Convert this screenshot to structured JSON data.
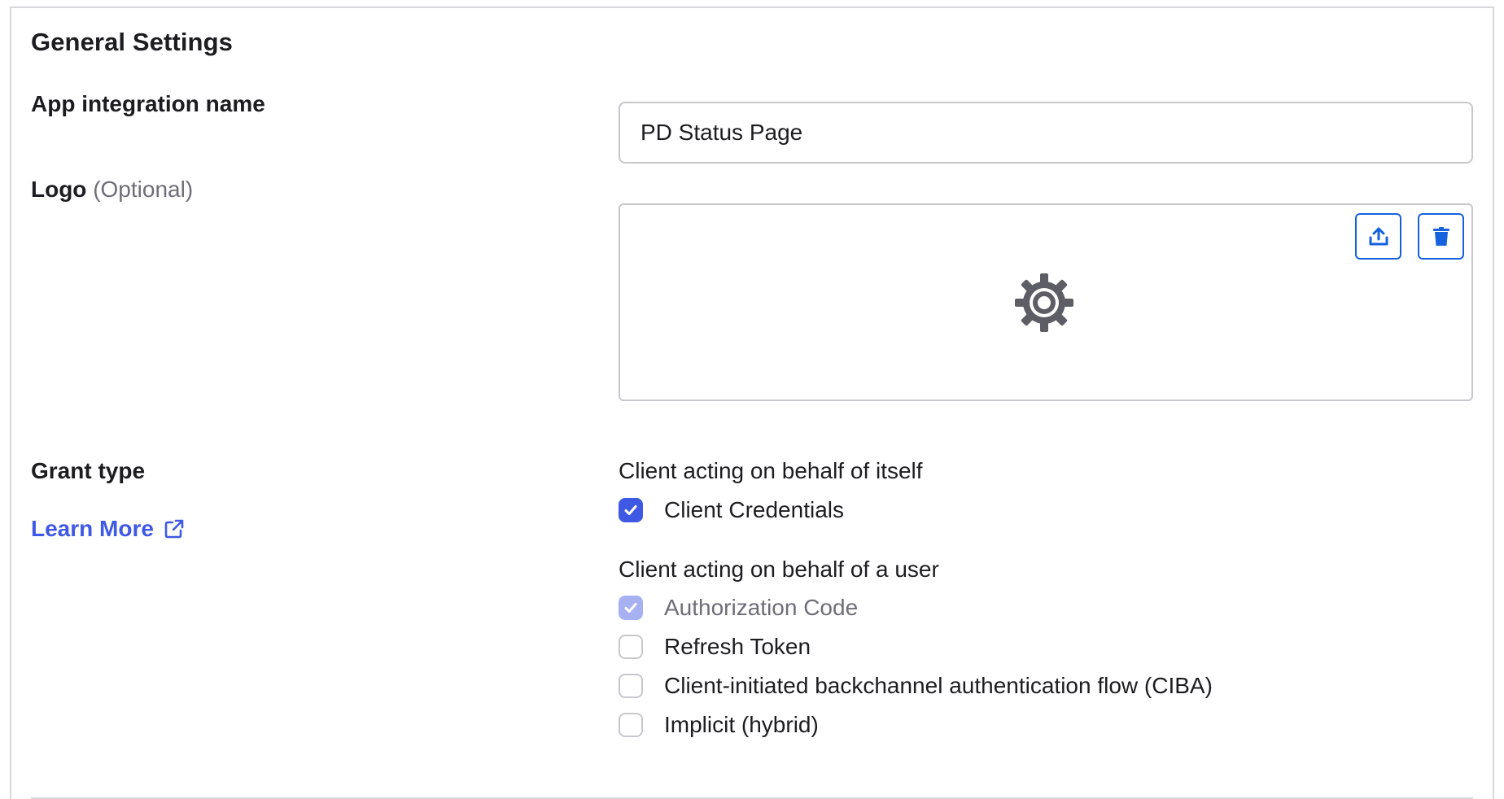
{
  "section": {
    "title": "General Settings"
  },
  "app_name": {
    "label": "App integration name",
    "value": "PD Status Page"
  },
  "logo": {
    "label": "Logo",
    "optional": "(Optional)",
    "upload_icon": "upload-icon",
    "delete_icon": "trash-icon",
    "placeholder_icon": "gear-icon"
  },
  "grant_type": {
    "label": "Grant type",
    "learn_more": "Learn More",
    "learn_more_icon": "external-link-icon",
    "group_self": {
      "heading": "Client acting on behalf of itself",
      "options": [
        {
          "label": "Client Credentials",
          "checked": true,
          "disabled": false
        }
      ]
    },
    "group_user": {
      "heading": "Client acting on behalf of a user",
      "options": [
        {
          "label": "Authorization Code",
          "checked": true,
          "disabled": true
        },
        {
          "label": "Refresh Token",
          "checked": false,
          "disabled": false
        },
        {
          "label": "Client-initiated backchannel authentication flow (CIBA)",
          "checked": false,
          "disabled": false
        },
        {
          "label": "Implicit (hybrid)",
          "checked": false,
          "disabled": false
        }
      ]
    }
  },
  "colors": {
    "accent": "#3f59e4",
    "accent_disabled": "#a7b1f2",
    "button_border": "#1662dd",
    "border": "#c7c7cd",
    "text": "#1d1d21",
    "muted": "#6e6e78"
  }
}
